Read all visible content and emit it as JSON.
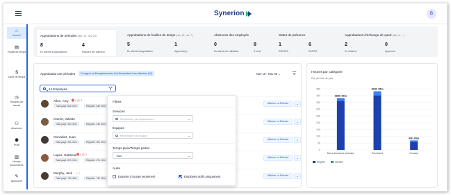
{
  "app": {
    "brand": "Synerion",
    "user_initial": "B"
  },
  "sidebar": {
    "items": [
      {
        "label": "Accueil",
        "icon": "home-icon",
        "glyph": "⌂"
      },
      {
        "label": "Feuille de temps",
        "icon": "timesheet-icon",
        "glyph": "▤"
      },
      {
        "label": "Carte de temps",
        "icon": "dollar-icon",
        "glyph": "$"
      },
      {
        "label": "Horaires de travail",
        "icon": "clock-icon",
        "glyph": "◷"
      },
      {
        "label": "Absences",
        "icon": "absences-icon",
        "glyph": "⚇"
      },
      {
        "label": "Profil",
        "icon": "people-icon",
        "glyph": "⚉"
      },
      {
        "label": "Heures accumulées",
        "icon": "accrued-hours-icon",
        "glyph": "▥"
      },
      {
        "label": "Approuver",
        "icon": "approve-icon",
        "glyph": "✎"
      }
    ]
  },
  "summary": {
    "pay_periods": {
      "title": "Approbations de périodes",
      "dates": "(déc. 15 - nov. 23)",
      "s1": {
        "value": "8",
        "label": "En attente d'approbations"
      },
      "s2": {
        "value": "4",
        "label": "Requiert de l'attention"
      }
    },
    "timesheets": {
      "title": "Approbations de feuilles de temps",
      "dates": "(nov. 24 - dc. 7)",
      "s1": {
        "value": "5",
        "label": "En attente d'approbation"
      },
      "s2": {
        "value": "1",
        "label": "Approuvé(s)"
      }
    },
    "absences": {
      "title": "Absences des employés",
      "s1": {
        "value": "0",
        "label": "En attente de validation"
      },
      "s2": {
        "value": "8",
        "label": "À venir"
      }
    },
    "presence": {
      "title": "Statut de présence",
      "s1": {
        "value": "1",
        "label": "ENTRÉS"
      },
      "s2": {
        "value": "6",
        "label": "SORTIS"
      }
    },
    "shift_swap": {
      "title": "Approbations d'échange de quart",
      "dates": "(déc. 4 - ...)",
      "s1": {
        "value": "2",
        "label": "En instance"
      },
      "s2": {
        "value": "0",
        "label": "Approuvé"
      }
    }
  },
  "main": {
    "title": "Approbation de périodes",
    "badge": "Corriger Les Enregistrements Qui Nécessitent Une Attention (10)",
    "date_range": "Nov 10 - Nov 23",
    "search_value": "14 Employés",
    "view_button": "Afficher La Période",
    "employees": [
      {
        "name": "Allen, Amy",
        "flags": "⓿ 1  ⚠ 2",
        "pay": "Total payé: 64h 00m",
        "reg": "Régulier: 64h 00m"
      },
      {
        "name": "Carrier, Juliette",
        "flags": "",
        "pay": "Total payé: 23h 30m",
        "reg": "Régulier: 23h 30m"
      },
      {
        "name": "Gonzalez, Juan",
        "flags": "",
        "pay": "Total payé: 20h 30m",
        "reg": "Régulier: 20h 30m"
      },
      {
        "name": "Lopez, Gabriela",
        "flags": "⓿ 1  ⚠ 1",
        "pay": "Total payé: 67h 15m",
        "reg": "Régulier: 67h 15m"
      },
      {
        "name": "Murphy, Jack",
        "flags": "⚠ 1",
        "pay": "Total payé: 74h 45m",
        "reg": "Régulier: 74h 45m"
      }
    ]
  },
  "filters": {
    "title": "Filtres",
    "services_label": "Services",
    "services_placeholder": "Rechercher par département",
    "teams_label": "Équipes",
    "teams_placeholder": "Rechercher par équipe",
    "time_label": "Temps plein/Temps partiel",
    "time_value": "Tous",
    "other_label": "Autre",
    "opt_export": "Exporter à la paie seulement",
    "opt_active": "Employés actifs uniquement",
    "opt_export_checked": false,
    "opt_active_checked": true
  },
  "chart_data": {
    "type": "bar",
    "title": "Heures par catégorie",
    "subtitle": "Par période de paie",
    "categories": [
      "Deux dernières périodes",
      "Précédent",
      "Courant"
    ],
    "series": [
      {
        "name": "Régulier",
        "values": [
          362,
          402,
          60
        ],
        "color": "#1e40af"
      },
      {
        "name": "Vacation",
        "values": [
          20,
          30,
          10
        ],
        "color": "#3b82f6"
      }
    ],
    "data_labels": [
      "382h 30m",
      "403h 15m",
      "69h 45m"
    ],
    "ylim": [
      0,
      450
    ],
    "yticks": [
      0,
      50,
      100,
      150,
      200,
      250,
      300,
      350,
      400,
      450
    ],
    "grid": true,
    "legend": "bottom-left"
  }
}
